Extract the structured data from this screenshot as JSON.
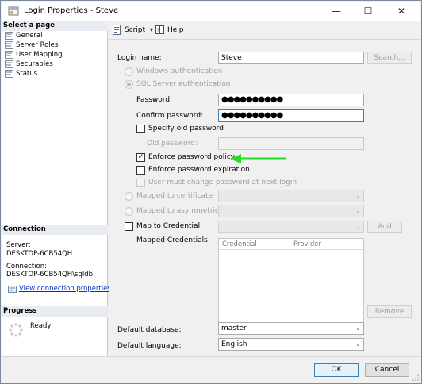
{
  "window": {
    "title": "Login Properties - Steve",
    "minimize_glyph": "—",
    "maximize_glyph": "☐",
    "close_glyph": "✕"
  },
  "left": {
    "select_page_header": "Select a page",
    "pages": [
      "General",
      "Server Roles",
      "User Mapping",
      "Securables",
      "Status"
    ],
    "connection_header": "Connection",
    "server_label": "Server:",
    "server_value": "DESKTOP-6CB54QH",
    "connection_label": "Connection:",
    "connection_value": "DESKTOP-6CB54QH\\sqldb",
    "view_connection_link": "View connection properties",
    "progress_header": "Progress",
    "progress_status": "Ready"
  },
  "toolbar": {
    "script_label": "Script",
    "help_label": "Help",
    "dropdown_glyph": "▾"
  },
  "form": {
    "login_name_label": "Login name:",
    "login_name_value": "Steve",
    "search_button": "Search...",
    "windows_auth_label": "Windows authentication",
    "sql_auth_label": "SQL Server authentication",
    "password_label": "Password:",
    "password_value": "●●●●●●●●●●",
    "confirm_password_label": "Confirm password:",
    "confirm_password_value": "●●●●●●●●●●",
    "specify_old_password_label": "Specify old password",
    "old_password_label": "Old password:",
    "enforce_policy_label": "Enforce password policy",
    "enforce_policy_checked": "✓",
    "enforce_expiration_label": "Enforce password expiration",
    "must_change_label": "User must change password at next login",
    "mapped_cert_label": "Mapped to certificate",
    "mapped_asym_label": "Mapped to asymmetric key",
    "map_credential_label": "Map to Credential",
    "add_button": "Add",
    "mapped_credentials_label": "Mapped Credentials",
    "grid_columns": [
      "Credential",
      "Provider"
    ],
    "remove_button": "Remove",
    "default_database_label": "Default database:",
    "default_database_value": "master",
    "default_language_label": "Default language:",
    "default_language_value": "English",
    "combo_arrow": "⌄"
  },
  "footer": {
    "ok_button": "OK",
    "cancel_button": "Cancel"
  },
  "colors": {
    "arrow_annotation": "#22dd22",
    "link": "#0033cc"
  }
}
